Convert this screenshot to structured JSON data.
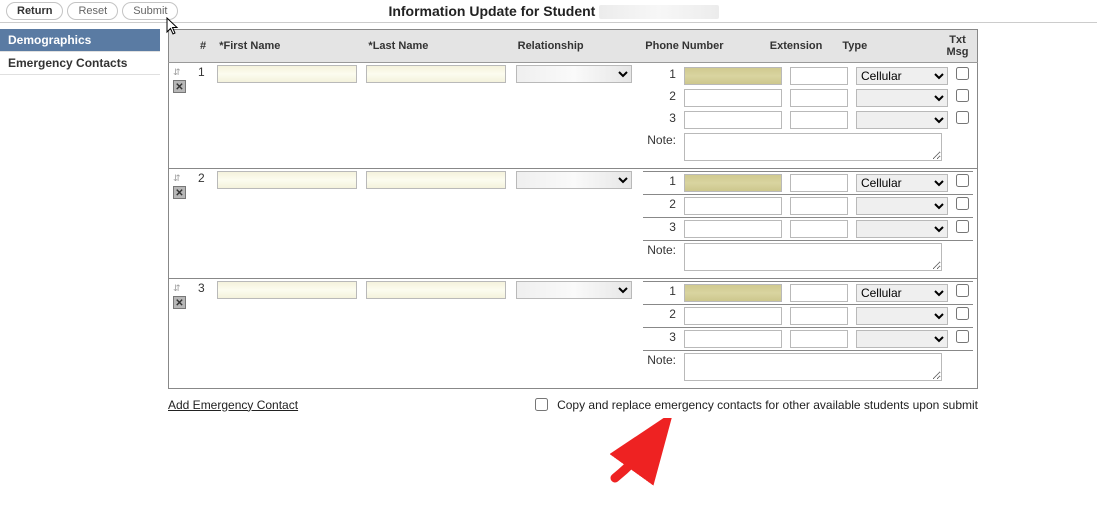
{
  "topbar": {
    "return": "Return",
    "reset": "Reset",
    "submit": "Submit"
  },
  "title": "Information Update for Student",
  "sidebar": {
    "items": [
      {
        "label": "Demographics",
        "active": true
      },
      {
        "label": "Emergency Contacts",
        "active": false
      }
    ]
  },
  "columns": {
    "handle": "",
    "num": "#",
    "first": "*First Name",
    "last": "*Last Name",
    "rel": "Relationship",
    "phone": "Phone Number",
    "ext": "Extension",
    "type": "Type",
    "txt": "Txt Msg"
  },
  "type_options": [
    "",
    "Cellular"
  ],
  "contacts": [
    {
      "num": "1",
      "first": "",
      "last": "",
      "rel": "",
      "phones": [
        {
          "label": "1",
          "number": "",
          "ext": "",
          "type": "Cellular",
          "txt": false,
          "hl": true
        },
        {
          "label": "2",
          "number": "",
          "ext": "",
          "type": "",
          "txt": false,
          "hl": false
        },
        {
          "label": "3",
          "number": "",
          "ext": "",
          "type": "",
          "txt": false,
          "hl": false
        }
      ],
      "note_label": "Note:",
      "note": ""
    },
    {
      "num": "2",
      "first": "",
      "last": "",
      "rel": "",
      "phones": [
        {
          "label": "1",
          "number": "",
          "ext": "",
          "type": "Cellular",
          "txt": false,
          "hl": true
        },
        {
          "label": "2",
          "number": "",
          "ext": "",
          "type": "",
          "txt": false,
          "hl": false
        },
        {
          "label": "3",
          "number": "",
          "ext": "",
          "type": "",
          "txt": false,
          "hl": false
        }
      ],
      "note_label": "Note:",
      "note": ""
    },
    {
      "num": "3",
      "first": "",
      "last": "",
      "rel": "",
      "phones": [
        {
          "label": "1",
          "number": "",
          "ext": "",
          "type": "Cellular",
          "txt": false,
          "hl": true
        },
        {
          "label": "2",
          "number": "",
          "ext": "",
          "type": "",
          "txt": false,
          "hl": false
        },
        {
          "label": "3",
          "number": "",
          "ext": "",
          "type": "",
          "txt": false,
          "hl": false
        }
      ],
      "note_label": "Note:",
      "note": ""
    }
  ],
  "footer": {
    "add": "Add Emergency Contact",
    "copy": "Copy and replace emergency contacts for other available students upon submit"
  }
}
